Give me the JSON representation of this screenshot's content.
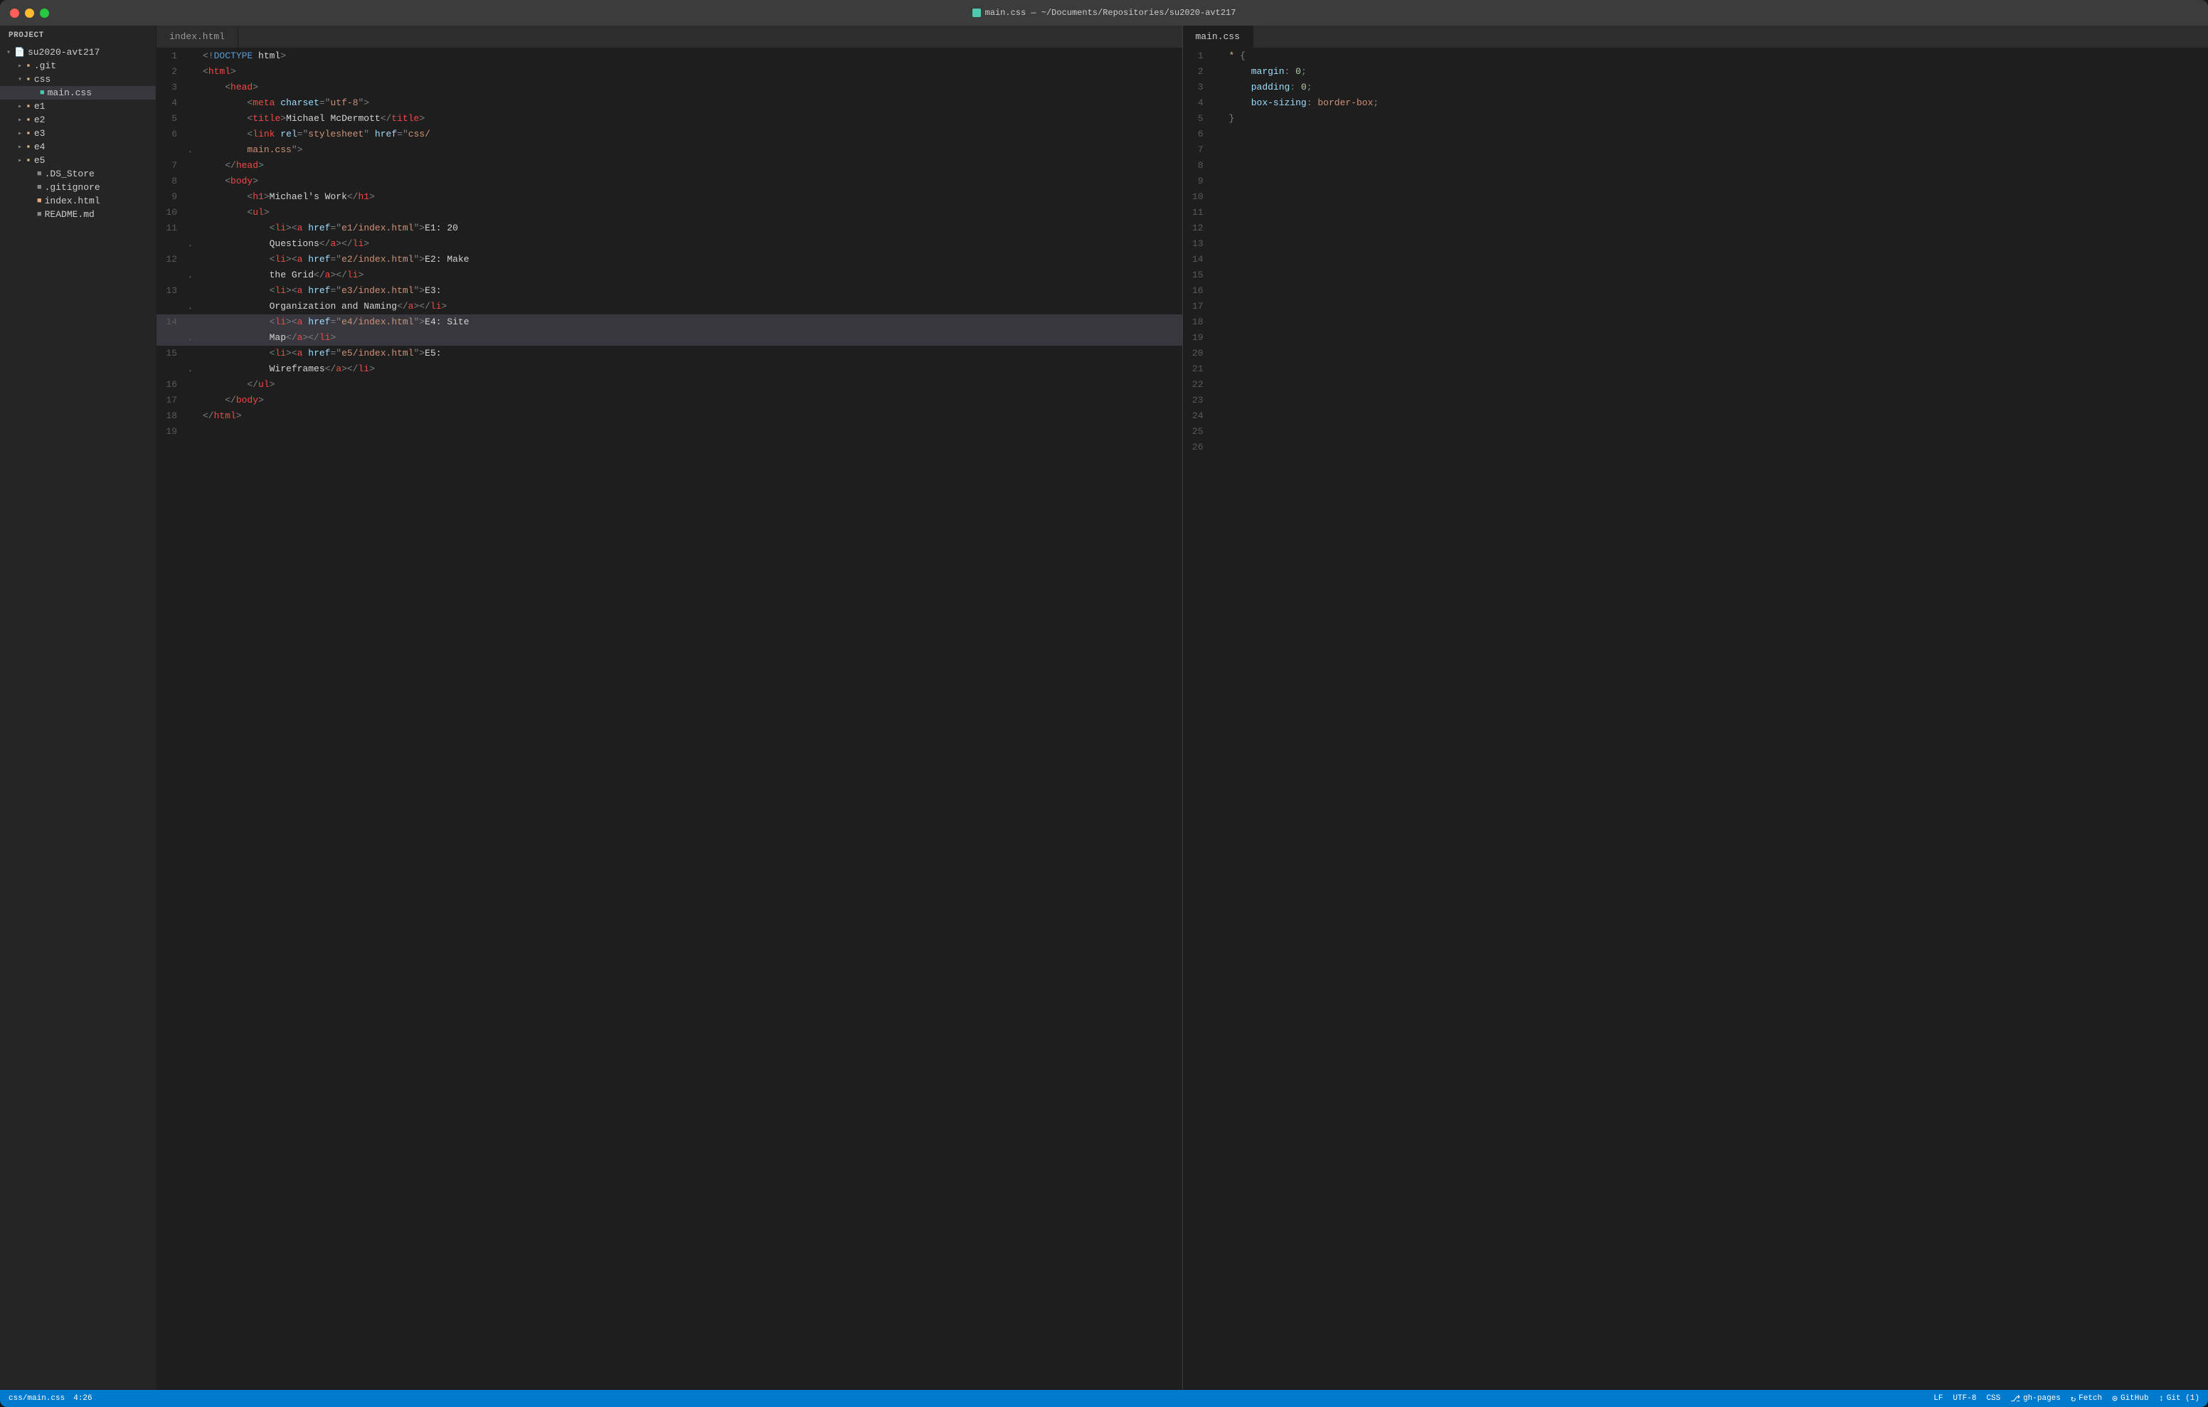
{
  "window": {
    "title": "main.css — ~/Documents/Repositories/su2020-avt217",
    "title_icon": "css-file-icon"
  },
  "traffic_lights": {
    "red_label": "close",
    "yellow_label": "minimize",
    "green_label": "maximize"
  },
  "sidebar": {
    "title": "Project",
    "root": {
      "name": "su2020-avt217",
      "expanded": true,
      "children": [
        {
          "name": ".git",
          "type": "folder",
          "expanded": false,
          "depth": 1
        },
        {
          "name": "css",
          "type": "folder",
          "expanded": true,
          "depth": 1
        },
        {
          "name": "main.css",
          "type": "file-css",
          "active": true,
          "depth": 2
        },
        {
          "name": "e1",
          "type": "folder",
          "expanded": false,
          "depth": 1
        },
        {
          "name": "e2",
          "type": "folder",
          "expanded": false,
          "depth": 1
        },
        {
          "name": "e3",
          "type": "folder",
          "expanded": false,
          "depth": 1
        },
        {
          "name": "e4",
          "type": "folder",
          "expanded": false,
          "depth": 1
        },
        {
          "name": "e5",
          "type": "folder",
          "expanded": false,
          "depth": 1
        },
        {
          "name": ".DS_Store",
          "type": "file",
          "depth": 1
        },
        {
          "name": ".gitignore",
          "type": "file",
          "depth": 1
        },
        {
          "name": "index.html",
          "type": "file-html",
          "depth": 1
        },
        {
          "name": "README.md",
          "type": "file-md",
          "depth": 1
        }
      ]
    }
  },
  "tabs": {
    "left": [
      {
        "label": "index.html",
        "active": false
      }
    ],
    "right": [
      {
        "label": "main.css",
        "active": true
      }
    ]
  },
  "editor_left": {
    "lines": [
      {
        "num": 1,
        "dot": false,
        "content": "<!DOCTYPE html>"
      },
      {
        "num": 2,
        "dot": false,
        "content": "<html>"
      },
      {
        "num": 3,
        "dot": false,
        "content": "    <head>"
      },
      {
        "num": 4,
        "dot": false,
        "content": "        <meta charset=\"utf-8\">"
      },
      {
        "num": 5,
        "dot": false,
        "content": "        <title>Michael McDermott</title>"
      },
      {
        "num": 6,
        "dot": false,
        "content": "        <link rel=\"stylesheet\" href=\"css/"
      },
      {
        "num": 6,
        "dot": true,
        "content": "        main.css\">"
      },
      {
        "num": 7,
        "dot": false,
        "content": "    </head>"
      },
      {
        "num": 8,
        "dot": false,
        "content": "    <body>"
      },
      {
        "num": 9,
        "dot": false,
        "content": "        <h1>Michael's Work</h1>"
      },
      {
        "num": 10,
        "dot": false,
        "content": "        <ul>"
      },
      {
        "num": 11,
        "dot": false,
        "content": "            <li><a href=\"e1/index.html\">E1: 20"
      },
      {
        "num": 11,
        "dot": true,
        "content": "            Questions</a></li>"
      },
      {
        "num": 12,
        "dot": false,
        "content": "            <li><a href=\"e2/index.html\">E2: Make"
      },
      {
        "num": 12,
        "dot": true,
        "content": "            the Grid</a></li>"
      },
      {
        "num": 13,
        "dot": false,
        "content": "            <li><a href=\"e3/index.html\">E3:"
      },
      {
        "num": 13,
        "dot": true,
        "content": "            Organization and Naming</a></li>"
      },
      {
        "num": 14,
        "dot": false,
        "content": "            <li><a href=\"e4/index.html\">E4: Site",
        "highlighted": true
      },
      {
        "num": 14,
        "dot": true,
        "content": "            Map</a></li>",
        "highlighted": true
      },
      {
        "num": 15,
        "dot": false,
        "content": "            <li><a href=\"e5/index.html\">E5:"
      },
      {
        "num": 15,
        "dot": true,
        "content": "            Wireframes</a></li>"
      },
      {
        "num": 16,
        "dot": false,
        "content": "        </ul>"
      },
      {
        "num": 17,
        "dot": false,
        "content": "    </body>"
      },
      {
        "num": 18,
        "dot": false,
        "content": "</html>"
      },
      {
        "num": 19,
        "dot": false,
        "content": ""
      }
    ]
  },
  "editor_right": {
    "lines": [
      {
        "num": 1,
        "dot": false,
        "content": "* {"
      },
      {
        "num": 2,
        "dot": false,
        "content": "    margin: 0;"
      },
      {
        "num": 3,
        "dot": false,
        "content": "    padding: 0;"
      },
      {
        "num": 4,
        "dot": false,
        "content": "    box-sizing: border-box;"
      },
      {
        "num": 5,
        "dot": false,
        "content": "}"
      },
      {
        "num": 6,
        "dot": false,
        "content": ""
      },
      {
        "num": 7,
        "dot": false,
        "content": ""
      },
      {
        "num": 8,
        "dot": false,
        "content": ""
      },
      {
        "num": 9,
        "dot": false,
        "content": ""
      },
      {
        "num": 10,
        "dot": false,
        "content": ""
      },
      {
        "num": 11,
        "dot": false,
        "content": ""
      },
      {
        "num": 12,
        "dot": false,
        "content": ""
      },
      {
        "num": 13,
        "dot": false,
        "content": ""
      },
      {
        "num": 14,
        "dot": false,
        "content": ""
      },
      {
        "num": 15,
        "dot": false,
        "content": ""
      },
      {
        "num": 16,
        "dot": false,
        "content": ""
      },
      {
        "num": 17,
        "dot": false,
        "content": ""
      },
      {
        "num": 18,
        "dot": false,
        "content": ""
      },
      {
        "num": 19,
        "dot": false,
        "content": ""
      },
      {
        "num": 20,
        "dot": false,
        "content": ""
      },
      {
        "num": 21,
        "dot": false,
        "content": ""
      },
      {
        "num": 22,
        "dot": false,
        "content": ""
      },
      {
        "num": 23,
        "dot": false,
        "content": ""
      },
      {
        "num": 24,
        "dot": false,
        "content": ""
      },
      {
        "num": 25,
        "dot": false,
        "content": ""
      },
      {
        "num": 26,
        "dot": false,
        "content": ""
      }
    ]
  },
  "status_bar": {
    "left": {
      "file_path": "css/main.css",
      "cursor": "4:26"
    },
    "right": {
      "line_ending": "LF",
      "encoding": "UTF-8",
      "language": "CSS",
      "branch_icon": "git-branch-icon",
      "branch": "gh-pages",
      "fetch_icon": "fetch-icon",
      "fetch": "Fetch",
      "github_icon": "github-icon",
      "github": "GitHub",
      "git_icon": "git-icon",
      "git": "Git (1)"
    }
  }
}
